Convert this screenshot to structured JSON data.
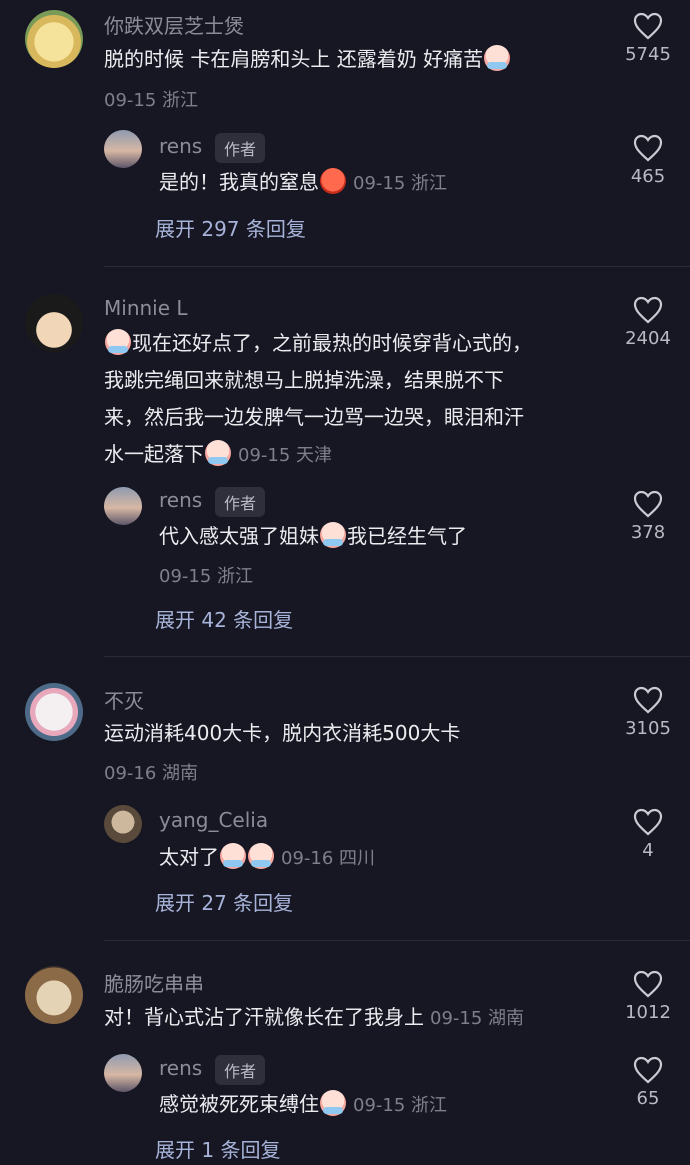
{
  "threads": [
    {
      "user": "你跌双层芝士煲",
      "text": "脱的时候 卡在肩膀和头上 还露着奶 好痛苦",
      "meta": "09-15 浙江",
      "likes": "5745",
      "reply": {
        "user": "rens",
        "badge": "作者",
        "text": "是的！我真的窒息",
        "meta": "09-15 浙江",
        "likes": "465"
      },
      "expand": "展开 297 条回复"
    },
    {
      "user": "Minnie L",
      "lines": [
        "现在还好点了，之前最热的时候穿背心式的，",
        "我跳完绳回来就想马上脱掉洗澡，结果脱不下",
        "来，然后我一边发脾气一边骂一边哭，眼泪和汗",
        "水一起落下"
      ],
      "meta": "09-15 天津",
      "likes": "2404",
      "reply": {
        "user": "rens",
        "badge": "作者",
        "text_a": "代入感太强了姐妹",
        "text_b": "我已经生气了",
        "meta": "09-15 浙江",
        "likes": "378"
      },
      "expand": "展开 42 条回复"
    },
    {
      "user": "不灭",
      "text": "运动消耗400大卡，脱内衣消耗500大卡",
      "meta": "09-16 湖南",
      "likes": "3105",
      "reply": {
        "user": "yang_Celia",
        "text": "太对了",
        "meta": "09-16 四川",
        "likes": "4"
      },
      "expand": "展开 27 条回复"
    },
    {
      "user": "脆肠吃串串",
      "text": "对！背心式沾了汗就像长在了我身上",
      "meta": "09-15 湖南",
      "likes": "1012",
      "reply": {
        "user": "rens",
        "badge": "作者",
        "text": "感觉被死死束缚住",
        "meta": "09-15 浙江",
        "likes": "65"
      },
      "expand": "展开 1 条回复"
    }
  ],
  "icons": {
    "like": "heart-outline-icon",
    "emoji_cry": "crying-emoji-icon",
    "emoji_angry": "angry-emoji-icon"
  }
}
